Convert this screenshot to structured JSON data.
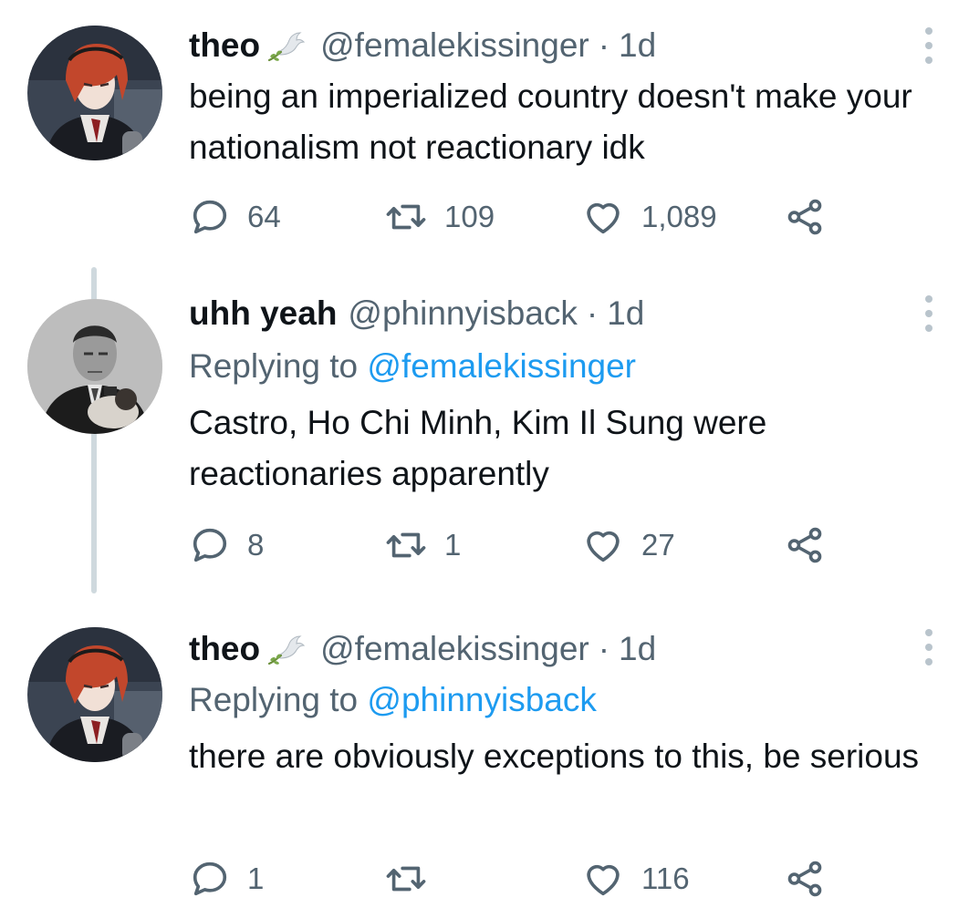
{
  "tweets": [
    {
      "name": "theo",
      "emoji": "dove-emoji",
      "handle": "@femalekissinger",
      "time": "1d",
      "replying_label": "",
      "replying_to": "",
      "text": "being an imperialized country doesn't make your nationalism not reactionary idk",
      "replies": "64",
      "retweets": "109",
      "likes": "1,089"
    },
    {
      "name": "uhh yeah",
      "handle": "@phinnyisback",
      "time": "1d",
      "replying_label": "Replying to",
      "replying_to": "@femalekissinger",
      "text": "Castro, Ho Chi Minh, Kim Il Sung were reactionaries apparently",
      "replies": "8",
      "retweets": "1",
      "likes": "27"
    },
    {
      "name": "theo",
      "emoji": "dove-emoji",
      "handle": "@femalekissinger",
      "time": "1d",
      "replying_label": "Replying to",
      "replying_to": "@phinnyisback",
      "text": "there are obviously exceptions to this, be serious",
      "replies": "1",
      "retweets": "",
      "likes": "116"
    }
  ],
  "separator": "·",
  "icons": {
    "reply": "reply-bubble-icon",
    "retweet": "retweet-icon",
    "like": "heart-icon",
    "share": "share-icon",
    "more": "more-options-icon"
  },
  "colors": {
    "text": "#0f1419",
    "secondary": "#536471",
    "accent": "#1d9bf0",
    "thread_line": "#cfd9de"
  }
}
